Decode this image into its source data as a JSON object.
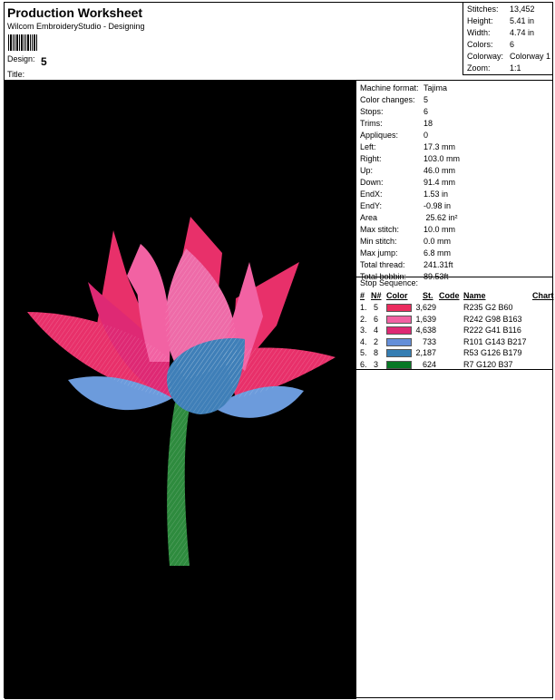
{
  "header": {
    "title": "Production Worksheet",
    "subtitle": "Wilcom EmbroideryStudio - Designing",
    "design_label": "Design:",
    "design_value": "5",
    "title_label": "Title:"
  },
  "meta": [
    {
      "key": "Stitches:",
      "value": "13,452"
    },
    {
      "key": "Height:",
      "value": "5.41 in"
    },
    {
      "key": "Width:",
      "value": "4.74 in"
    },
    {
      "key": "Colors:",
      "value": "6"
    },
    {
      "key": "Colorway:",
      "value": "Colorway 1"
    },
    {
      "key": "Zoom:",
      "value": "1:1"
    }
  ],
  "info": [
    {
      "key": "Machine format:",
      "value": "Tajima"
    },
    {
      "key": "Color changes:",
      "value": "5"
    },
    {
      "key": "Stops:",
      "value": "6"
    },
    {
      "key": "Trims:",
      "value": "18"
    },
    {
      "key": "Appliques:",
      "value": "0"
    },
    {
      "key": "Left:",
      "value": "17.3 mm"
    },
    {
      "key": "Right:",
      "value": "103.0 mm"
    },
    {
      "key": "Up:",
      "value": "46.0 mm"
    },
    {
      "key": "Down:",
      "value": "91.4 mm"
    },
    {
      "key": "EndX:",
      "value": "1.53 in"
    },
    {
      "key": "EndY:",
      "value": "-0.98 in"
    },
    {
      "key": "Area",
      "value": " 25.62 in²"
    },
    {
      "key": "Max stitch:",
      "value": "10.0 mm"
    },
    {
      "key": "Min stitch:",
      "value": "0.0 mm"
    },
    {
      "key": "Max jump:",
      "value": "6.8 mm"
    },
    {
      "key": "Total thread:",
      "value": "241.31ft"
    },
    {
      "key": "Total bobbin:",
      "value": "89.53ft"
    }
  ],
  "sequence": {
    "title": "Stop Sequence:",
    "headers": {
      "num": "#",
      "n": "N#",
      "color": "Color",
      "st": "St.",
      "code": "Code",
      "name": "Name",
      "chart": "Chart"
    },
    "rows": [
      {
        "num": "1.",
        "n": "5",
        "color": "#EB2C5E",
        "st": "3,629",
        "code": "",
        "name": "R235 G2 B60"
      },
      {
        "num": "2.",
        "n": "6",
        "color": "#F262A3",
        "st": "1,639",
        "code": "",
        "name": "R242 G98 B163"
      },
      {
        "num": "3.",
        "n": "4",
        "color": "#DE2974",
        "st": "4,638",
        "code": "",
        "name": "R222 G41 B116"
      },
      {
        "num": "4.",
        "n": "2",
        "color": "#658FD9",
        "st": "733",
        "code": "",
        "name": "R101 G143 B217"
      },
      {
        "num": "5.",
        "n": "8",
        "color": "#357EB3",
        "st": "2,187",
        "code": "",
        "name": "R53 G126 B179"
      },
      {
        "num": "6.",
        "n": "3",
        "color": "#077825",
        "st": "624",
        "code": "",
        "name": "R7 G120 B37"
      }
    ]
  },
  "preview": {
    "background": "#000000",
    "stem_color": "#2E8B3E",
    "petal_dark_pink": "#E8306A",
    "petal_pink": "#EE6BA8",
    "petal_blue": "#6C9BDC",
    "bud_blue": "#3F7FB8"
  }
}
